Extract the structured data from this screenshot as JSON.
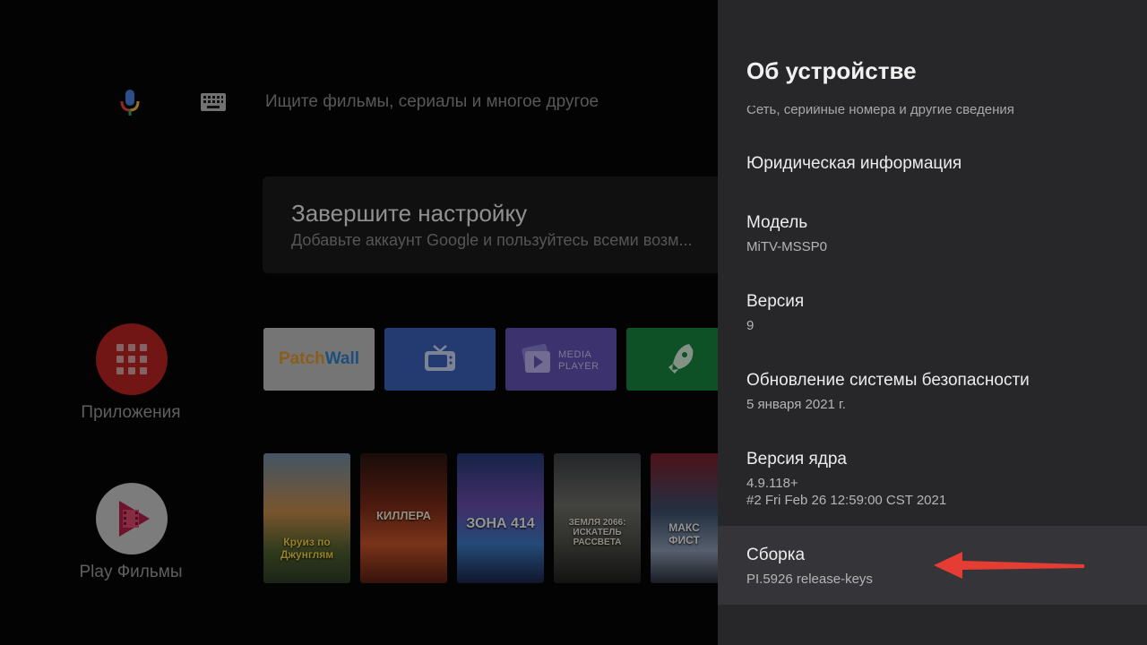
{
  "search": {
    "placeholder": "Ищите фильмы, сериалы и многое другое",
    "mic_icon": "mic-icon",
    "keyboard_icon": "keyboard-icon"
  },
  "setup_card": {
    "title": "Завершите настройку",
    "subtitle": "Добавьте аккаунт Google и пользуйтесь всеми возм..."
  },
  "sidebar": {
    "apps_label": "Приложения",
    "play_label": "Play Фильмы",
    "colors": {
      "apps": "#b62222",
      "play": "#c9c9c9"
    }
  },
  "app_row": {
    "patchwall_a": "Patch",
    "patchwall_b": "Wall",
    "media_line1": "MEDIA",
    "media_line2": "PLAYER"
  },
  "posters": [
    {
      "title": "Круиз по Джунглям"
    },
    {
      "title": "КИЛЛЕРА"
    },
    {
      "title": "ЗОНА 414"
    },
    {
      "title": "ЗЕМЛЯ 2066: ИСКАТЕЛЬ РАССВЕТА"
    },
    {
      "title": "МАКС ФИСТ"
    }
  ],
  "panel": {
    "title": "Об устройстве",
    "cut_subtitle": "Сеть, серийные номера и другие сведения",
    "items": [
      {
        "title": "Юридическая информация",
        "sub": ""
      },
      {
        "title": "Модель",
        "sub": "MiTV-MSSP0"
      },
      {
        "title": "Версия",
        "sub": "9"
      },
      {
        "title": "Обновление системы безопасности",
        "sub": "5 января 2021 г."
      },
      {
        "title": "Версия ядра",
        "sub": "4.9.118+",
        "sub2": "#2 Fri Feb 26 12:59:00 CST 2021"
      },
      {
        "title": "Сборка",
        "sub": "PI.5926 release-keys"
      }
    ]
  }
}
